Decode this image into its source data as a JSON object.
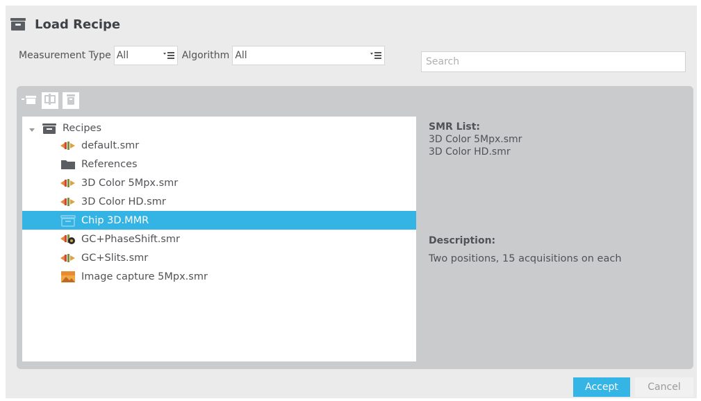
{
  "dialog": {
    "title": "Load Recipe"
  },
  "filters": {
    "measurement_type_label": "Measurement Type",
    "measurement_type_value": "All",
    "algorithm_label": "Algorithm",
    "algorithm_value": "All",
    "search_placeholder": "Search"
  },
  "toolbar": {
    "icons": [
      "new-recipe-icon",
      "rename-icon",
      "delete-icon"
    ]
  },
  "tree": {
    "root": "Recipes",
    "items": [
      {
        "label": "default.smr",
        "icon": "smr-file-icon"
      },
      {
        "label": "References",
        "icon": "folder-icon"
      },
      {
        "label": "3D Color 5Mpx.smr",
        "icon": "smr-file-icon"
      },
      {
        "label": "3D Color HD.smr",
        "icon": "smr-file-icon"
      },
      {
        "label": "Chip 3D.MMR",
        "icon": "mmr-file-icon",
        "selected": true
      },
      {
        "label": "GC+PhaseShift.smr",
        "icon": "smr-phase-file-icon"
      },
      {
        "label": "GC+Slits.smr",
        "icon": "smr-file-icon"
      },
      {
        "label": "Image capture 5Mpx.smr",
        "icon": "image-file-icon"
      }
    ]
  },
  "details": {
    "smr_list_heading": "SMR List:",
    "smr_list": [
      "3D Color 5Mpx.smr",
      "3D Color HD.smr"
    ],
    "description_heading": "Description:",
    "description": "Two positions, 15 acquisitions on each"
  },
  "buttons": {
    "accept": "Accept",
    "cancel": "Cancel"
  },
  "colors": {
    "accent": "#35b5e5",
    "panel": "#c9cbcd",
    "background": "#ebebeb"
  }
}
